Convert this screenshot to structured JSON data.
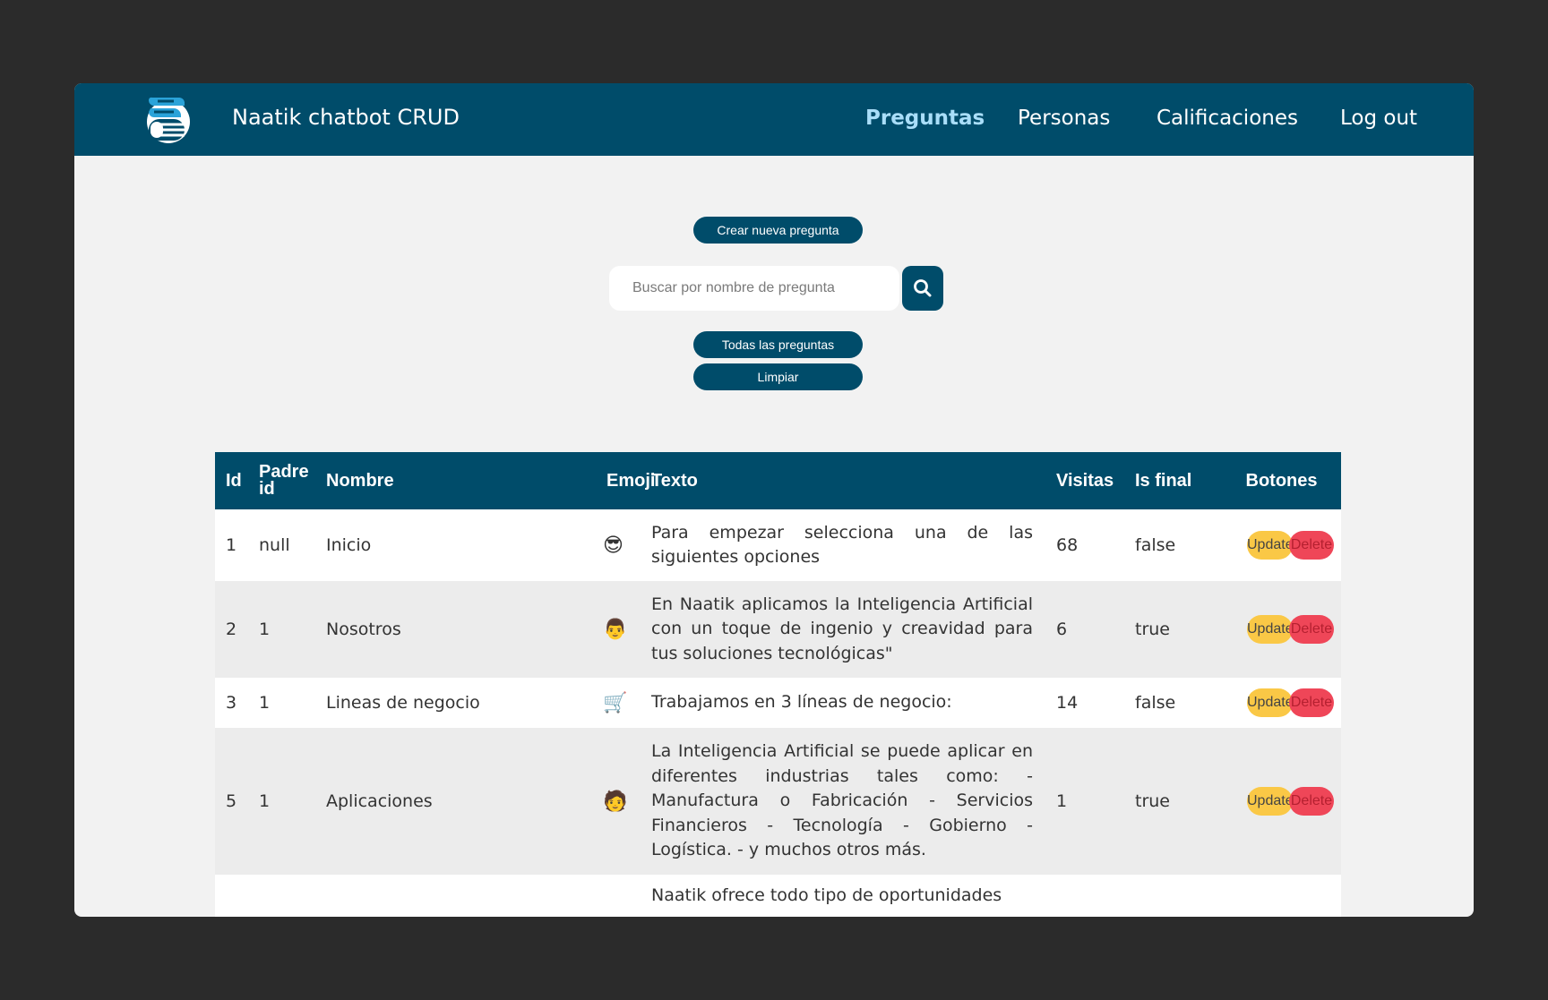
{
  "navbar": {
    "brand": "Naatik chatbot CRUD",
    "links": [
      "Preguntas",
      "Personas",
      "Calificaciones",
      "Log out"
    ],
    "active": "Preguntas",
    "color": "#004c6a",
    "active_color": "#a9def9"
  },
  "actions": {
    "create_label": "Crear nueva pregunta",
    "all_label": "Todas las preguntas",
    "clear_label": "Limpiar"
  },
  "search": {
    "placeholder": "Buscar por nombre de pregunta",
    "value": "",
    "icon": "search-icon"
  },
  "table": {
    "headers": {
      "id": "Id",
      "padre": "Padre id",
      "nombre": "Nombre",
      "emoji": "Emoji",
      "texto": "Texto",
      "visitas": "Visitas",
      "final": "Is final",
      "botones": "Botones"
    },
    "update_label": "Update",
    "delete_label": "Delete",
    "update_color": "#fac846",
    "delete_color": "#ef4658",
    "rows": [
      {
        "id": "1",
        "padre": "null",
        "nombre": "Inicio",
        "emoji": "😎",
        "texto": "Para empezar selecciona una de las siguientes opciones",
        "visitas": "68",
        "final": "false"
      },
      {
        "id": "2",
        "padre": "1",
        "nombre": "Nosotros",
        "emoji": "👨",
        "texto": "En Naatik aplicamos la Inteligencia Artificial con un toque de ingenio y creavidad para tus soluciones tecnológicas\"",
        "visitas": "6",
        "final": "true"
      },
      {
        "id": "3",
        "padre": "1",
        "nombre": "Lineas de negocio",
        "emoji": "🛒",
        "texto": "Trabajamos en 3 líneas de negocio:",
        "visitas": "14",
        "final": "false"
      },
      {
        "id": "5",
        "padre": "1",
        "nombre": "Aplicaciones",
        "emoji": "🧑",
        "texto": "La Inteligencia Artificial se puede aplicar en diferentes industrias tales como: - Manufactura o Fabricación - Servicios Financieros - Tecnología - Gobierno - Logística. - y muchos otros más.",
        "visitas": "1",
        "final": "true"
      },
      {
        "id": "",
        "padre": "",
        "nombre": "",
        "emoji": "",
        "texto": "Naatik ofrece todo tipo de oportunidades",
        "visitas": "",
        "final": ""
      }
    ]
  }
}
